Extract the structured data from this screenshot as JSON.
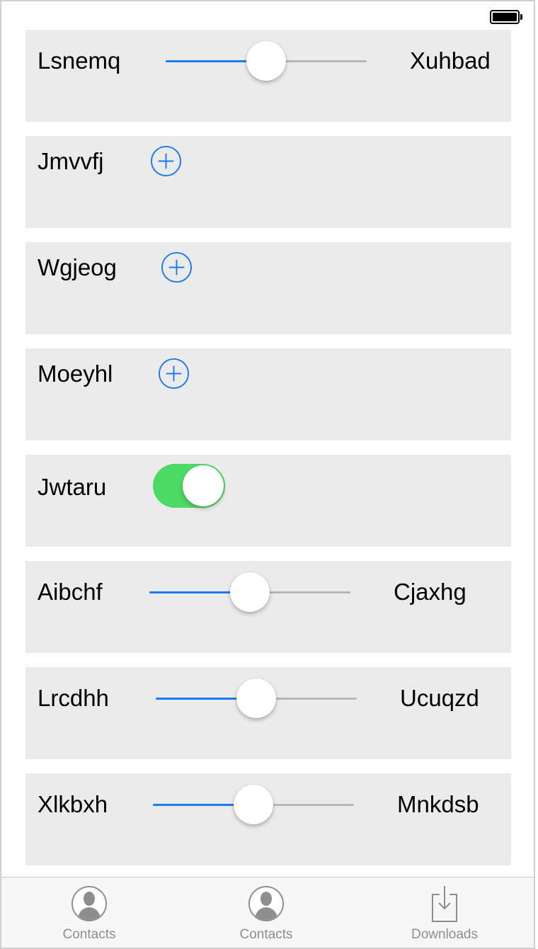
{
  "status_bar": {
    "battery_icon": "battery-full-icon"
  },
  "rows": [
    {
      "type": "slider",
      "label": "Lsnemq",
      "value_label": "Xuhbad",
      "level": 0.5
    },
    {
      "type": "add",
      "label": "Jmvvfj",
      "icon": "plus-circle-icon"
    },
    {
      "type": "add",
      "label": "Wgjeog",
      "icon": "plus-circle-icon"
    },
    {
      "type": "add",
      "label": "Moeyhl",
      "icon": "plus-circle-icon"
    },
    {
      "type": "toggle",
      "label": "Jwtaru",
      "on": true
    },
    {
      "type": "slider",
      "label": "Aibchf",
      "value_label": "Cjaxhg",
      "level": 0.5
    },
    {
      "type": "slider",
      "label": "Lrcdhh",
      "value_label": "Ucuqzd",
      "level": 0.5
    },
    {
      "type": "slider",
      "label": "Xlkbxh",
      "value_label": "Mnkdsb",
      "level": 0.5
    }
  ],
  "tabbar": {
    "tabs": [
      {
        "label": "Contacts",
        "icon": "contact-icon"
      },
      {
        "label": "Contacts",
        "icon": "contact-icon"
      },
      {
        "label": "Downloads",
        "icon": "download-icon"
      }
    ]
  },
  "colors": {
    "accent": "#1a7cf0",
    "toggle_on": "#4cd964",
    "row_background": "#ebebeb",
    "tab_label": "#8e8e8e"
  }
}
